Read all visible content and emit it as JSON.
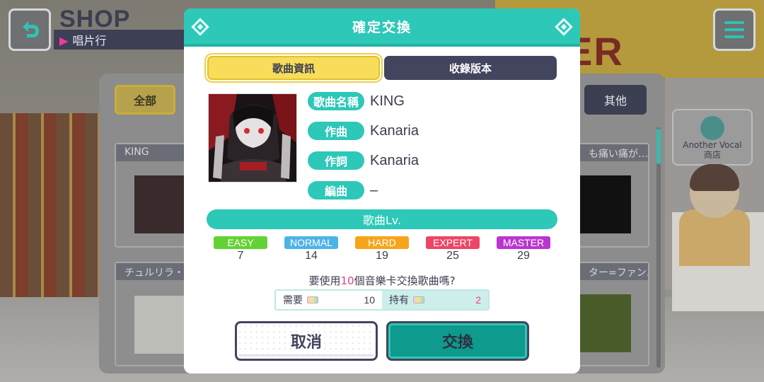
{
  "header": {
    "title": "SHOP",
    "subtitle": "唱片行"
  },
  "background": {
    "filter_all": "全部",
    "filter_other": "其他",
    "cards": [
      {
        "title": "KING"
      },
      {
        "title": "チュルリラ・"
      },
      {
        "title": "も痛い痛が…"
      },
      {
        "title": "ター=ファン…"
      }
    ],
    "another_vocal": "Another Vocal",
    "another_vocal_sub": "商店",
    "wall_sign": "ER"
  },
  "modal": {
    "title": "確定交換",
    "tabs": [
      {
        "label": "歌曲資訊",
        "active": true
      },
      {
        "label": "收錄版本",
        "active": false
      }
    ],
    "song": {
      "name_label": "歌曲名稱",
      "name": "KING",
      "composer_label": "作曲",
      "composer": "Kanaria",
      "lyricist_label": "作詞",
      "lyricist": "Kanaria",
      "arranger_label": "編曲",
      "arranger": "–"
    },
    "level_title": "歌曲Lv.",
    "difficulties": [
      {
        "name": "EASY",
        "level": "7",
        "color": "#62d234"
      },
      {
        "name": "NORMAL",
        "level": "14",
        "color": "#4db3e6"
      },
      {
        "name": "HARD",
        "level": "19",
        "color": "#f6a51b"
      },
      {
        "name": "EXPERT",
        "level": "25",
        "color": "#ee4566"
      },
      {
        "name": "MASTER",
        "level": "29",
        "color": "#bb36d0"
      }
    ],
    "question_prefix": "要使用",
    "question_count": "10",
    "question_suffix": "個音樂卡交換歌曲嗎?",
    "cost": {
      "need_label": "需要",
      "need_value": "10",
      "have_label": "持有",
      "have_value": "2"
    },
    "cancel_label": "取消",
    "exchange_label": "交換"
  },
  "colors": {
    "accent": "#2dc8b8",
    "dark": "#43455e",
    "highlight": "#ee3a8c"
  }
}
